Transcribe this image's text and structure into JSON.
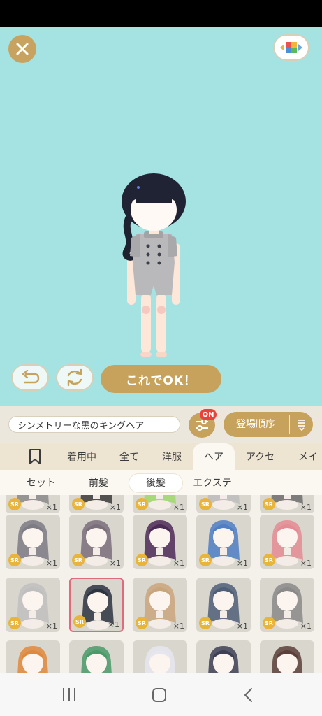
{
  "header": {
    "close_icon": "close-icon",
    "palette_icon": "palette-icon",
    "accent_color": "#c7a25d",
    "stage_color": "#a4e3e2"
  },
  "actions": {
    "undo_icon": "undo-icon",
    "refresh_icon": "refresh-icon",
    "ok_label": "これでOK！"
  },
  "item": {
    "name": "シンメトリーな黒のキングヘア"
  },
  "filter": {
    "badge": "ON",
    "icon": "sliders-icon"
  },
  "sort": {
    "label": "登場順序",
    "icon": "sort-icon"
  },
  "tabs": [
    {
      "label": "着用中"
    },
    {
      "label": "全て"
    },
    {
      "label": "洋服"
    },
    {
      "label": "ヘア"
    },
    {
      "label": "アクセ"
    },
    {
      "label": "メイク"
    }
  ],
  "subtabs": [
    {
      "label": "セット"
    },
    {
      "label": "前髪"
    },
    {
      "label": "後髪"
    },
    {
      "label": "エクステ"
    }
  ],
  "grid": {
    "rarity": "SR",
    "items": [
      {
        "qty": "×1",
        "hair": "#8a8a8a"
      },
      {
        "qty": "×1",
        "hair": "#3b3b3b"
      },
      {
        "qty": "×1",
        "hair": "#9fd86a"
      },
      {
        "qty": "×1",
        "hair": "#bdbdbd"
      },
      {
        "qty": "×1",
        "hair": "#6d6d6d"
      },
      {
        "qty": "×1",
        "hair": "#7d7b84"
      },
      {
        "qty": "×1",
        "hair": "#7a6f7a"
      },
      {
        "qty": "×1",
        "hair": "#4c2a56"
      },
      {
        "qty": "×1",
        "hair": "#4e7ec4"
      },
      {
        "qty": "×1",
        "hair": "#e48b93"
      },
      {
        "qty": "×1",
        "hair": "#bfbfbf"
      },
      {
        "qty": "×1",
        "hair": "#2b3440"
      },
      {
        "qty": "×1",
        "hair": "#c9a57c"
      },
      {
        "qty": "×1",
        "hair": "#4f5f78"
      },
      {
        "qty": "×1",
        "hair": "#8a8a8a"
      },
      {
        "qty": "",
        "hair": "#e0883c"
      },
      {
        "qty": "",
        "hair": "#4b9a6a"
      },
      {
        "qty": "",
        "hair": "#e6e6ee"
      },
      {
        "qty": "",
        "hair": "#3d3f55"
      },
      {
        "qty": "",
        "hair": "#5a3f3a"
      }
    ]
  },
  "navbar": {
    "recent_icon": "recent-apps-icon",
    "home_icon": "home-icon",
    "back_icon": "back-icon"
  }
}
